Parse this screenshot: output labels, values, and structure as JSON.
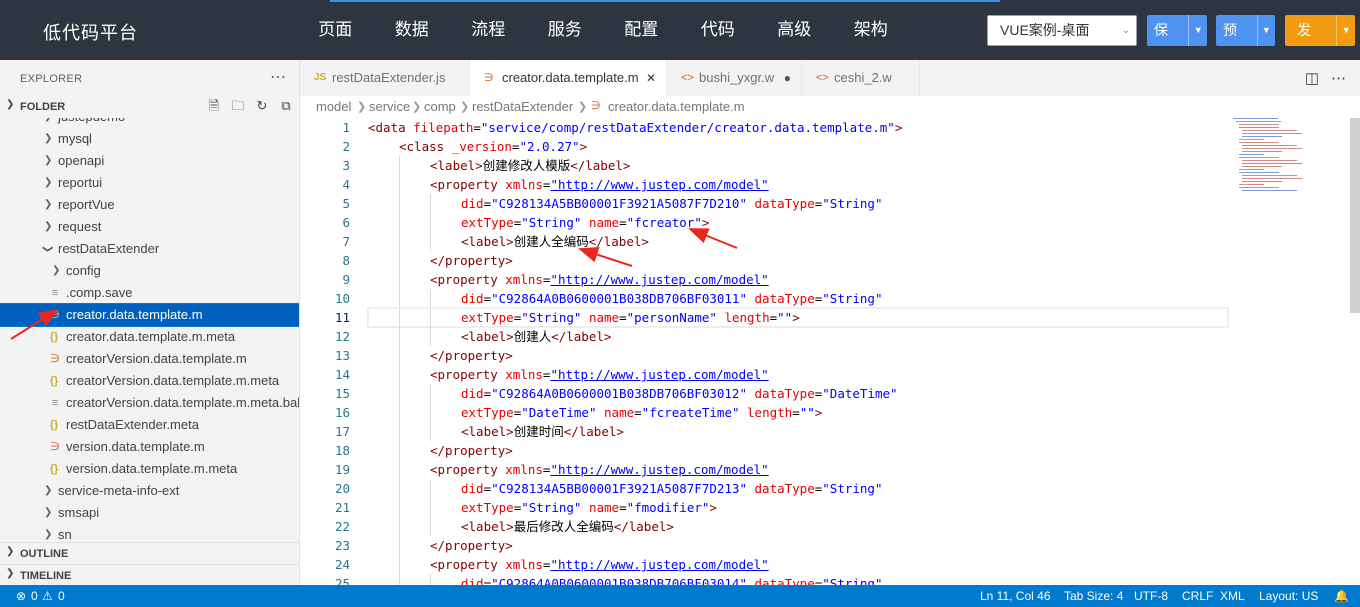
{
  "app": {
    "title": "低代码平台"
  },
  "top_menu": [
    {
      "label": "页面"
    },
    {
      "label": "数据"
    },
    {
      "label": "流程"
    },
    {
      "label": "服务"
    },
    {
      "label": "配置"
    },
    {
      "label": "代码"
    },
    {
      "label": "高级"
    },
    {
      "label": "架构"
    }
  ],
  "top_menu_active": "代码",
  "project_select": {
    "value": "VUE案例-桌面"
  },
  "buttons": {
    "save": "保存",
    "preview": "预览",
    "publish": "发布"
  },
  "colors": {
    "topbar": "#2d3640",
    "primary": "#4f93f1",
    "publish": "#f39c12",
    "selection": "#0060c0",
    "statusbar": "#007acc"
  },
  "sidebar": {
    "explorer_label": "EXPLORER",
    "folder_label": "FOLDER",
    "tree": [
      {
        "label": "justepdemo",
        "kind": "folder"
      },
      {
        "label": "mysql",
        "kind": "folder"
      },
      {
        "label": "openapi",
        "kind": "folder"
      },
      {
        "label": "reportui",
        "kind": "folder"
      },
      {
        "label": "reportVue",
        "kind": "folder"
      },
      {
        "label": "request",
        "kind": "folder"
      },
      {
        "label": "restDataExtender",
        "kind": "folder-open"
      },
      {
        "label": "config",
        "kind": "folder"
      },
      {
        "label": ".comp.save",
        "kind": "file"
      },
      {
        "label": "creator.data.template.m",
        "kind": "rss"
      },
      {
        "label": "creator.data.template.m.meta",
        "kind": "json"
      },
      {
        "label": "creatorVersion.data.template.m",
        "kind": "rss"
      },
      {
        "label": "creatorVersion.data.template.m.meta",
        "kind": "json"
      },
      {
        "label": "creatorVersion.data.template.m.meta.bak",
        "kind": "file"
      },
      {
        "label": "restDataExtender.meta",
        "kind": "json"
      },
      {
        "label": "version.data.template.m",
        "kind": "rss"
      },
      {
        "label": "version.data.template.m.meta",
        "kind": "json"
      },
      {
        "label": "service-meta-info-ext",
        "kind": "folder"
      },
      {
        "label": "smsapi",
        "kind": "folder"
      },
      {
        "label": "sn",
        "kind": "folder"
      }
    ],
    "outline_label": "OUTLINE",
    "timeline_label": "TIMELINE"
  },
  "tabs": [
    {
      "label": "restDataExtender.js",
      "icon": "JS"
    },
    {
      "label": "creator.data.template.m",
      "icon": "rss"
    },
    {
      "label": "bushi_yxgr.w",
      "icon": "<>"
    },
    {
      "label": "ceshi_2.w",
      "icon": "<>"
    }
  ],
  "breadcrumb": [
    "model",
    "service",
    "comp",
    "restDataExtender",
    "creator.data.template.m"
  ],
  "code": {
    "line_numbers": [
      "1",
      "2",
      "3",
      "4",
      "5",
      "6",
      "7",
      "8",
      "9",
      "10",
      "11",
      "12",
      "13",
      "14",
      "15",
      "16",
      "17",
      "18",
      "19",
      "20",
      "21",
      "22",
      "23",
      "24",
      "25"
    ],
    "current_line": "11"
  },
  "status": {
    "errors": "0",
    "warnings": "0",
    "position": "Ln 11, Col 46",
    "tab_size": "Tab Size: 4",
    "encoding": "UTF-8",
    "eol": "CRLF",
    "language": "XML",
    "layout": "Layout: US"
  }
}
